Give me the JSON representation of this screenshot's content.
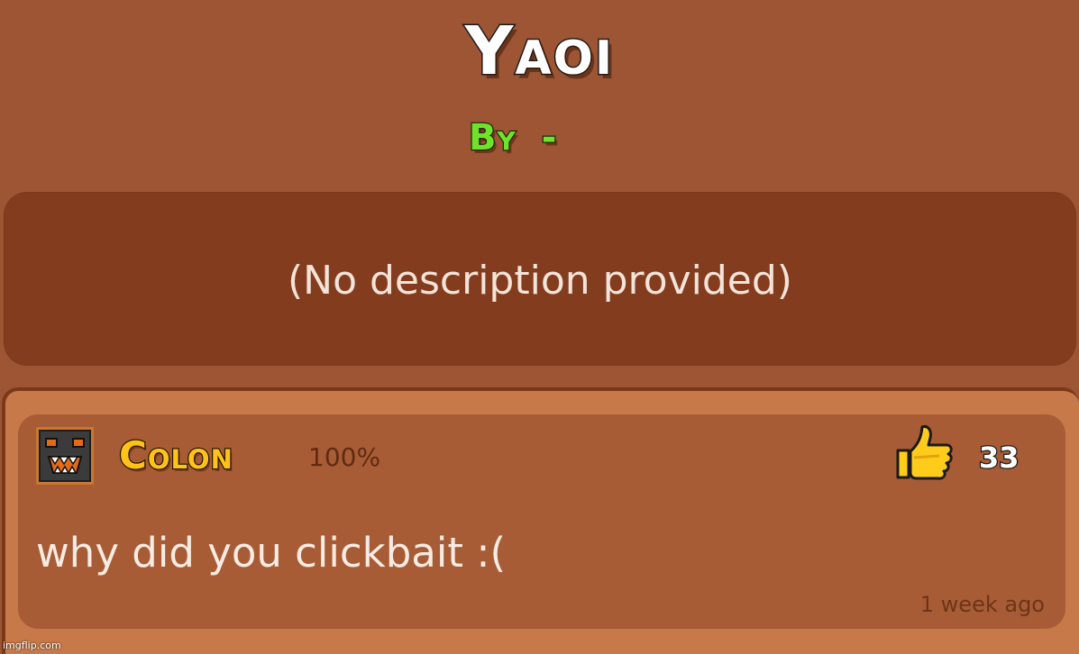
{
  "level": {
    "title": "Yaoi",
    "by_label": "By",
    "author": "-"
  },
  "description": {
    "text": "(No description provided)"
  },
  "comment": {
    "username": "Colon",
    "percent": "100%",
    "text": "why did you clickbait :(",
    "likes": "33",
    "timestamp": "1 week ago",
    "avatar_icon": "angry-cube-icon",
    "like_icon": "thumbs-up-icon"
  },
  "colors": {
    "background": "#9e5534",
    "description_box": "#833d1e",
    "comment_card": "#a85c35",
    "author_green": "#6fe32c",
    "username_gold": "#ffc21a"
  },
  "watermark": "imgflip.com"
}
